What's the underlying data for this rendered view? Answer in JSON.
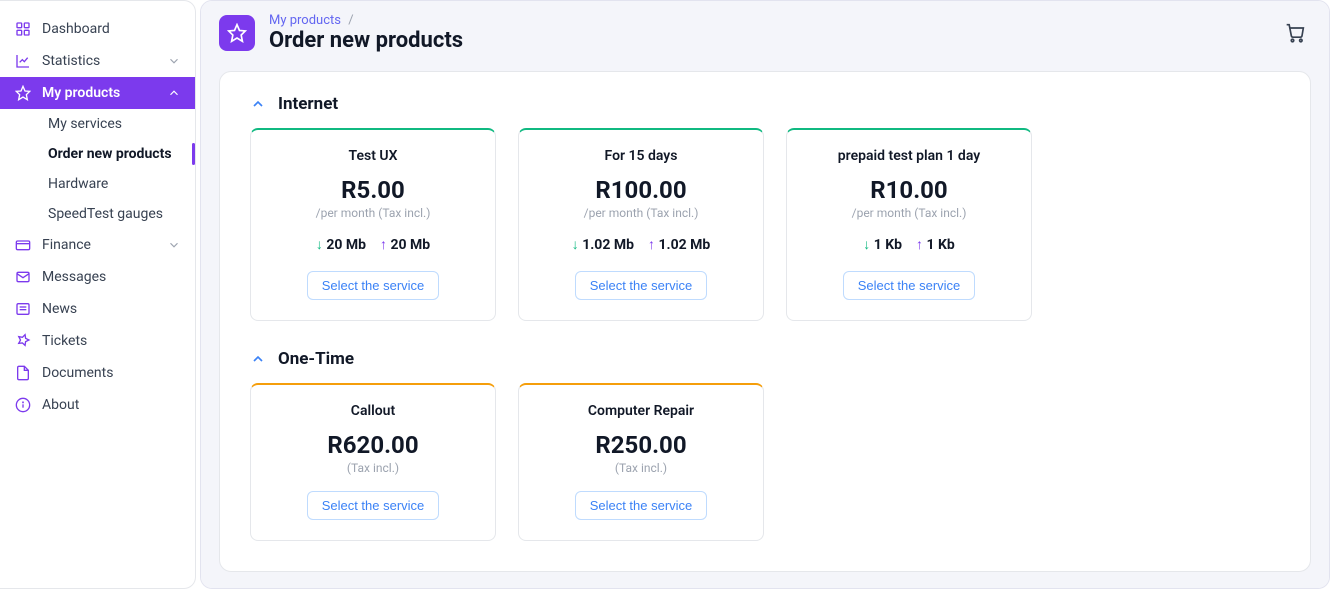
{
  "sidebar": {
    "items": [
      {
        "label": "Dashboard"
      },
      {
        "label": "Statistics"
      },
      {
        "label": "My products"
      },
      {
        "label": "Finance"
      },
      {
        "label": "Messages"
      },
      {
        "label": "News"
      },
      {
        "label": "Tickets"
      },
      {
        "label": "Documents"
      },
      {
        "label": "About"
      }
    ],
    "products_sub": [
      {
        "label": "My services"
      },
      {
        "label": "Order new products"
      },
      {
        "label": "Hardware"
      },
      {
        "label": "SpeedTest gauges"
      }
    ]
  },
  "header": {
    "breadcrumb_root": "My products",
    "title": "Order new products"
  },
  "sections": {
    "internet": {
      "title": "Internet",
      "products": [
        {
          "name": "Test UX",
          "price": "R5.00",
          "sub": "/per month (Tax incl.)",
          "down": "20 Mb",
          "up": "20 Mb"
        },
        {
          "name": "For 15 days",
          "price": "R100.00",
          "sub": "/per month (Tax incl.)",
          "down": "1.02 Mb",
          "up": "1.02 Mb"
        },
        {
          "name": "prepaid test plan 1 day",
          "price": "R10.00",
          "sub": "/per month (Tax incl.)",
          "down": "1 Kb",
          "up": "1 Kb"
        }
      ]
    },
    "onetime": {
      "title": "One-Time",
      "products": [
        {
          "name": "Callout",
          "price": "R620.00",
          "sub": "(Tax incl.)"
        },
        {
          "name": "Computer Repair",
          "price": "R250.00",
          "sub": "(Tax incl.)"
        }
      ]
    }
  },
  "labels": {
    "select_service": "Select the service"
  }
}
